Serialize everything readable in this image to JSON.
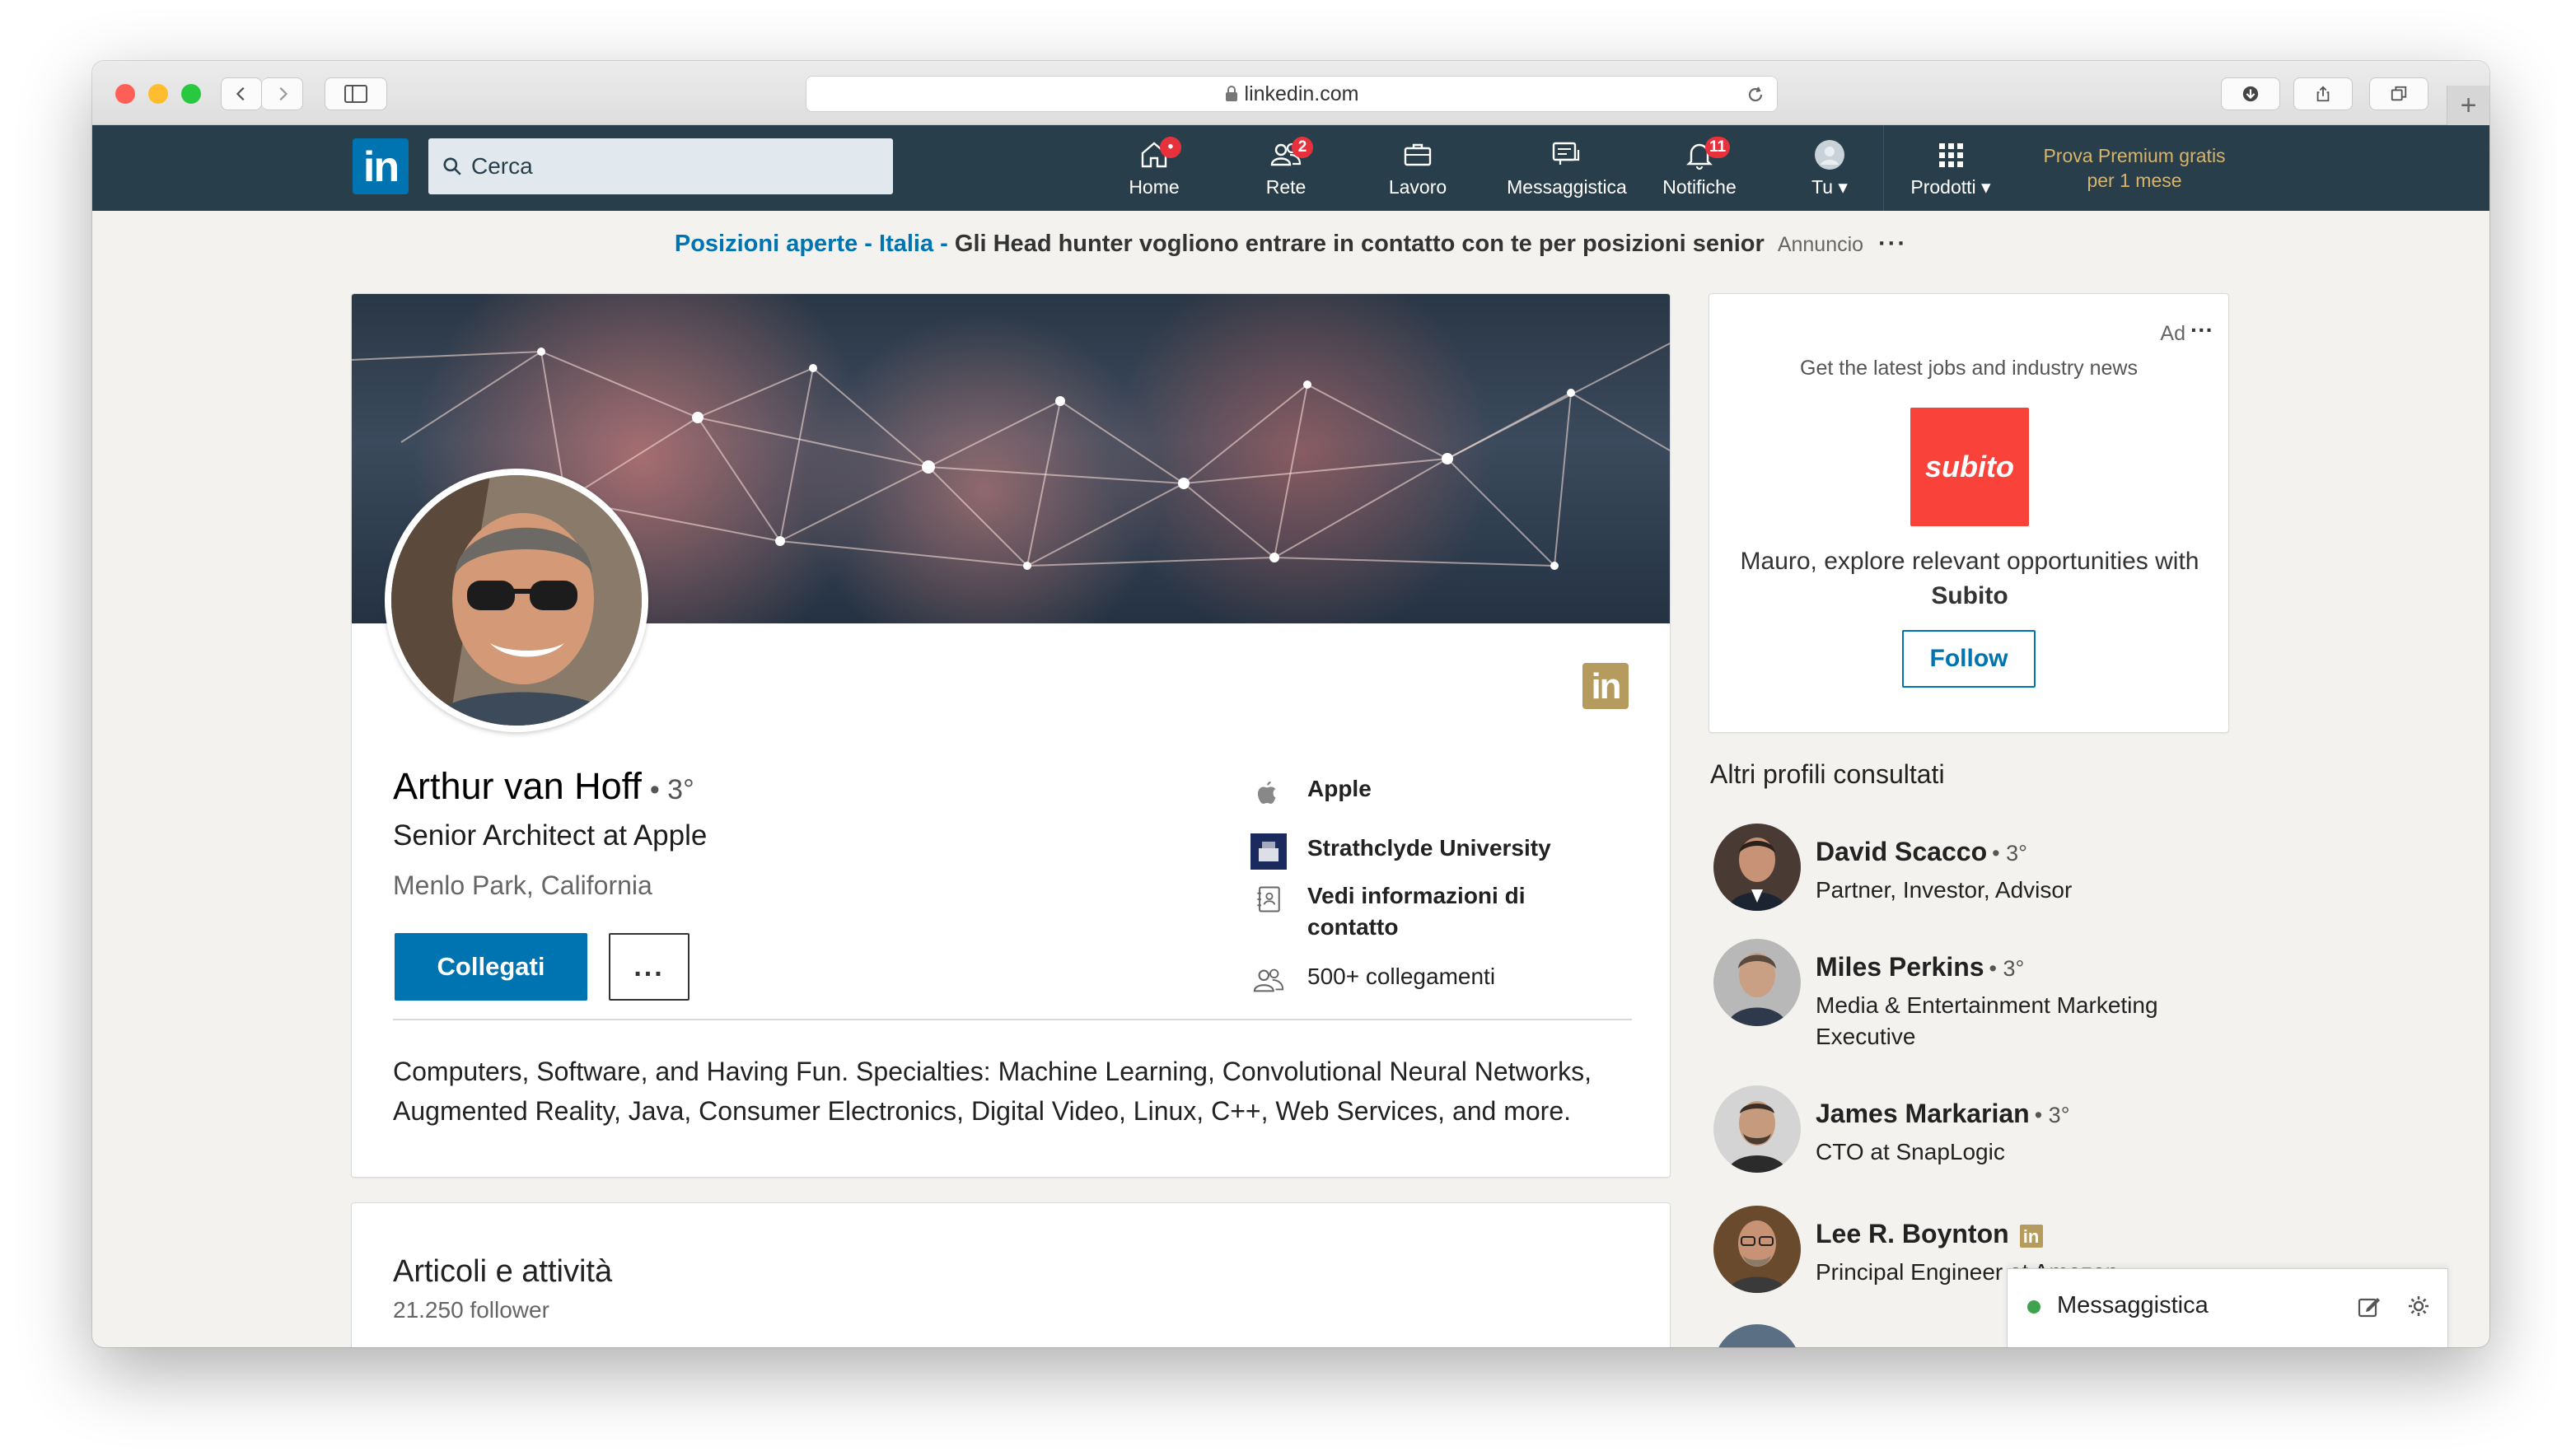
{
  "browser": {
    "url": "linkedin.com"
  },
  "nav": {
    "logo": "in",
    "search_placeholder": "Cerca",
    "items": [
      {
        "label": "Home",
        "badge": "•"
      },
      {
        "label": "Rete",
        "badge": "2"
      },
      {
        "label": "Lavoro",
        "badge": ""
      },
      {
        "label": "Messaggistica",
        "badge": ""
      },
      {
        "label": "Notifiche",
        "badge": "11"
      },
      {
        "label": "Tu ▾",
        "badge": ""
      },
      {
        "label": "Prodotti ▾",
        "badge": ""
      }
    ],
    "premium_line1": "Prova Premium gratis",
    "premium_line2": "per 1 mese"
  },
  "banner": {
    "link": "Posizioni aperte - Italia -",
    "message": "Gli Head hunter vogliono entrare in contatto con te per posizioni senior",
    "tag": "Annuncio",
    "dots": "···"
  },
  "profile": {
    "name": "Arthur van Hoff",
    "degree": "• 3°",
    "headline": "Senior Architect at Apple",
    "location": "Menlo Park, California",
    "connect_label": "Collegati",
    "more_label": "...",
    "company": "Apple",
    "school": "Strathclyde University",
    "contact_info_line1": "Vedi informazioni di",
    "contact_info_line2": "contatto",
    "connections": "500+ collegamenti",
    "badge": "in",
    "summary": "Computers, Software, and Having Fun. Specialties: Machine Learning, Convolutional Neural Networks, Augmented Reality, Java, Consumer Electronics, Digital Video, Linux, C++, Web Services, and more."
  },
  "articles": {
    "title": "Articoli e attività",
    "followers": "21.250 follower"
  },
  "ad": {
    "label": "Ad",
    "dots": "···",
    "text": "Get the latest jobs and industry news",
    "brand": "subito",
    "message": "Mauro, explore relevant opportunities with",
    "brand_name": "Subito",
    "follow_label": "Follow"
  },
  "others": {
    "title": "Altri profili consultati",
    "people": [
      {
        "name": "David Scacco",
        "degree": "• 3°",
        "title": "Partner, Investor, Advisor"
      },
      {
        "name": "Miles Perkins",
        "degree": "• 3°",
        "title": "Media & Entertainment Marketing Executive"
      },
      {
        "name": "James Markarian",
        "degree": "• 3°",
        "title": "CTO at SnapLogic"
      },
      {
        "name": "Lee R. Boynton",
        "degree": "",
        "title": "Principal Engineer at Amazon"
      }
    ]
  },
  "messaging": {
    "label": "Messaggistica"
  }
}
